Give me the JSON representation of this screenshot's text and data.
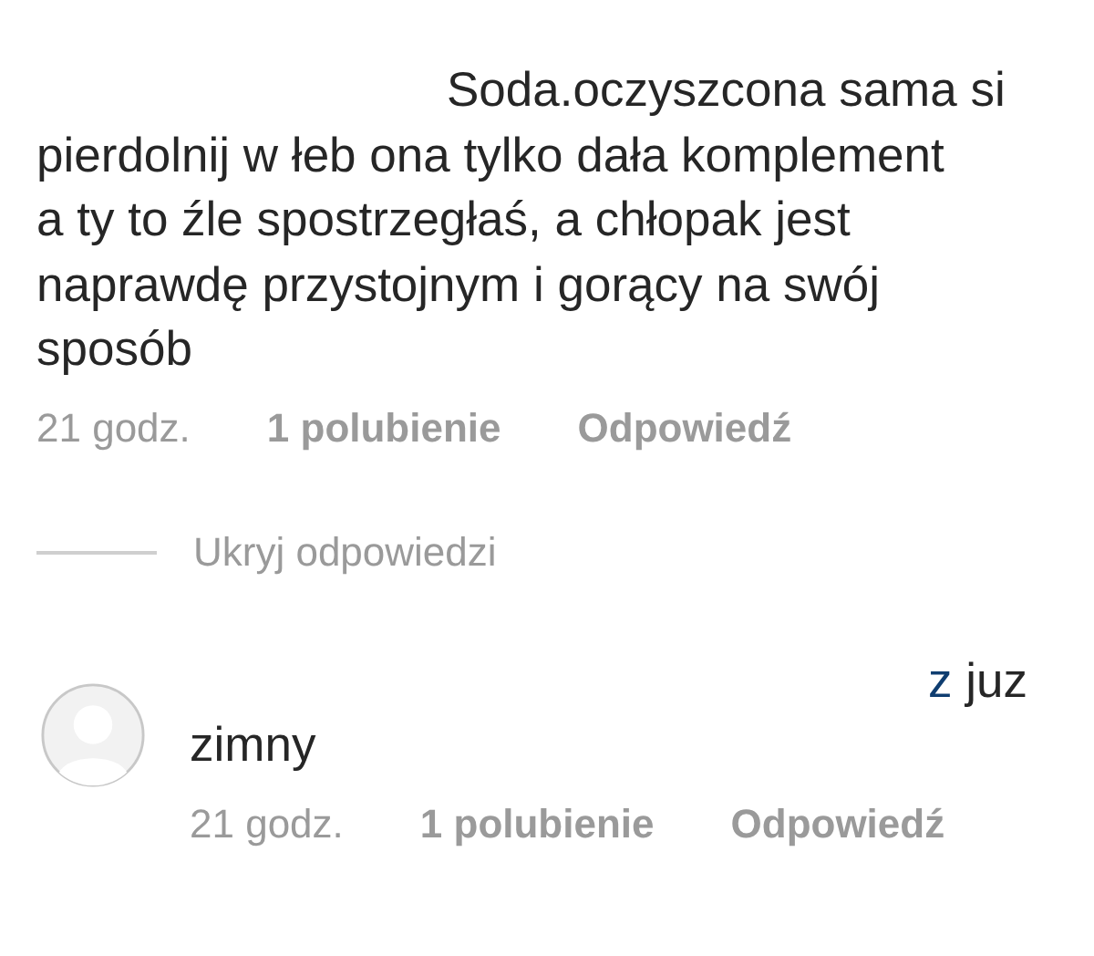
{
  "comments": [
    {
      "kind": "comment",
      "lines": [
        [
          {
            "kind": "plain",
            "text": "Soda.oczyszcona sama si"
          }
        ],
        [
          {
            "kind": "plain",
            "text": "pierdolnij w łeb ona tylko dała komplement"
          }
        ],
        [
          {
            "kind": "plain",
            "text": "a ty to źle spostrzegłaś, a chłopak jest"
          }
        ],
        [
          {
            "kind": "plain",
            "text": "naprawdę przystojnym i gorący na swój"
          }
        ],
        [
          {
            "kind": "plain",
            "text": "sposób"
          }
        ]
      ],
      "time": "21 godz.",
      "likes": "1 polubienie",
      "reply": "Odpowiedź"
    },
    {
      "kind": "toggle",
      "label": "Ukryj odpowiedzi"
    },
    {
      "kind": "reply",
      "lines": [
        [
          {
            "kind": "mention",
            "text": "z"
          },
          {
            "kind": "plain",
            "text": " juz"
          }
        ],
        [
          {
            "kind": "plain",
            "text": "zimny"
          }
        ]
      ],
      "time": "21 godz.",
      "likes": "1 polubienie",
      "reply": "Odpowiedź"
    }
  ]
}
